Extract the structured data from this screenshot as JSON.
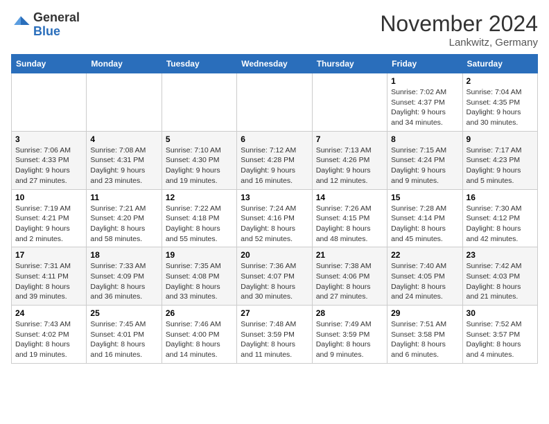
{
  "logo": {
    "general": "General",
    "blue": "Blue"
  },
  "title": "November 2024",
  "location": "Lankwitz, Germany",
  "days_of_week": [
    "Sunday",
    "Monday",
    "Tuesday",
    "Wednesday",
    "Thursday",
    "Friday",
    "Saturday"
  ],
  "weeks": [
    [
      {
        "day": "",
        "detail": ""
      },
      {
        "day": "",
        "detail": ""
      },
      {
        "day": "",
        "detail": ""
      },
      {
        "day": "",
        "detail": ""
      },
      {
        "day": "",
        "detail": ""
      },
      {
        "day": "1",
        "detail": "Sunrise: 7:02 AM\nSunset: 4:37 PM\nDaylight: 9 hours\nand 34 minutes."
      },
      {
        "day": "2",
        "detail": "Sunrise: 7:04 AM\nSunset: 4:35 PM\nDaylight: 9 hours\nand 30 minutes."
      }
    ],
    [
      {
        "day": "3",
        "detail": "Sunrise: 7:06 AM\nSunset: 4:33 PM\nDaylight: 9 hours\nand 27 minutes."
      },
      {
        "day": "4",
        "detail": "Sunrise: 7:08 AM\nSunset: 4:31 PM\nDaylight: 9 hours\nand 23 minutes."
      },
      {
        "day": "5",
        "detail": "Sunrise: 7:10 AM\nSunset: 4:30 PM\nDaylight: 9 hours\nand 19 minutes."
      },
      {
        "day": "6",
        "detail": "Sunrise: 7:12 AM\nSunset: 4:28 PM\nDaylight: 9 hours\nand 16 minutes."
      },
      {
        "day": "7",
        "detail": "Sunrise: 7:13 AM\nSunset: 4:26 PM\nDaylight: 9 hours\nand 12 minutes."
      },
      {
        "day": "8",
        "detail": "Sunrise: 7:15 AM\nSunset: 4:24 PM\nDaylight: 9 hours\nand 9 minutes."
      },
      {
        "day": "9",
        "detail": "Sunrise: 7:17 AM\nSunset: 4:23 PM\nDaylight: 9 hours\nand 5 minutes."
      }
    ],
    [
      {
        "day": "10",
        "detail": "Sunrise: 7:19 AM\nSunset: 4:21 PM\nDaylight: 9 hours\nand 2 minutes."
      },
      {
        "day": "11",
        "detail": "Sunrise: 7:21 AM\nSunset: 4:20 PM\nDaylight: 8 hours\nand 58 minutes."
      },
      {
        "day": "12",
        "detail": "Sunrise: 7:22 AM\nSunset: 4:18 PM\nDaylight: 8 hours\nand 55 minutes."
      },
      {
        "day": "13",
        "detail": "Sunrise: 7:24 AM\nSunset: 4:16 PM\nDaylight: 8 hours\nand 52 minutes."
      },
      {
        "day": "14",
        "detail": "Sunrise: 7:26 AM\nSunset: 4:15 PM\nDaylight: 8 hours\nand 48 minutes."
      },
      {
        "day": "15",
        "detail": "Sunrise: 7:28 AM\nSunset: 4:14 PM\nDaylight: 8 hours\nand 45 minutes."
      },
      {
        "day": "16",
        "detail": "Sunrise: 7:30 AM\nSunset: 4:12 PM\nDaylight: 8 hours\nand 42 minutes."
      }
    ],
    [
      {
        "day": "17",
        "detail": "Sunrise: 7:31 AM\nSunset: 4:11 PM\nDaylight: 8 hours\nand 39 minutes."
      },
      {
        "day": "18",
        "detail": "Sunrise: 7:33 AM\nSunset: 4:09 PM\nDaylight: 8 hours\nand 36 minutes."
      },
      {
        "day": "19",
        "detail": "Sunrise: 7:35 AM\nSunset: 4:08 PM\nDaylight: 8 hours\nand 33 minutes."
      },
      {
        "day": "20",
        "detail": "Sunrise: 7:36 AM\nSunset: 4:07 PM\nDaylight: 8 hours\nand 30 minutes."
      },
      {
        "day": "21",
        "detail": "Sunrise: 7:38 AM\nSunset: 4:06 PM\nDaylight: 8 hours\nand 27 minutes."
      },
      {
        "day": "22",
        "detail": "Sunrise: 7:40 AM\nSunset: 4:05 PM\nDaylight: 8 hours\nand 24 minutes."
      },
      {
        "day": "23",
        "detail": "Sunrise: 7:42 AM\nSunset: 4:03 PM\nDaylight: 8 hours\nand 21 minutes."
      }
    ],
    [
      {
        "day": "24",
        "detail": "Sunrise: 7:43 AM\nSunset: 4:02 PM\nDaylight: 8 hours\nand 19 minutes."
      },
      {
        "day": "25",
        "detail": "Sunrise: 7:45 AM\nSunset: 4:01 PM\nDaylight: 8 hours\nand 16 minutes."
      },
      {
        "day": "26",
        "detail": "Sunrise: 7:46 AM\nSunset: 4:00 PM\nDaylight: 8 hours\nand 14 minutes."
      },
      {
        "day": "27",
        "detail": "Sunrise: 7:48 AM\nSunset: 3:59 PM\nDaylight: 8 hours\nand 11 minutes."
      },
      {
        "day": "28",
        "detail": "Sunrise: 7:49 AM\nSunset: 3:59 PM\nDaylight: 8 hours\nand 9 minutes."
      },
      {
        "day": "29",
        "detail": "Sunrise: 7:51 AM\nSunset: 3:58 PM\nDaylight: 8 hours\nand 6 minutes."
      },
      {
        "day": "30",
        "detail": "Sunrise: 7:52 AM\nSunset: 3:57 PM\nDaylight: 8 hours\nand 4 minutes."
      }
    ]
  ]
}
